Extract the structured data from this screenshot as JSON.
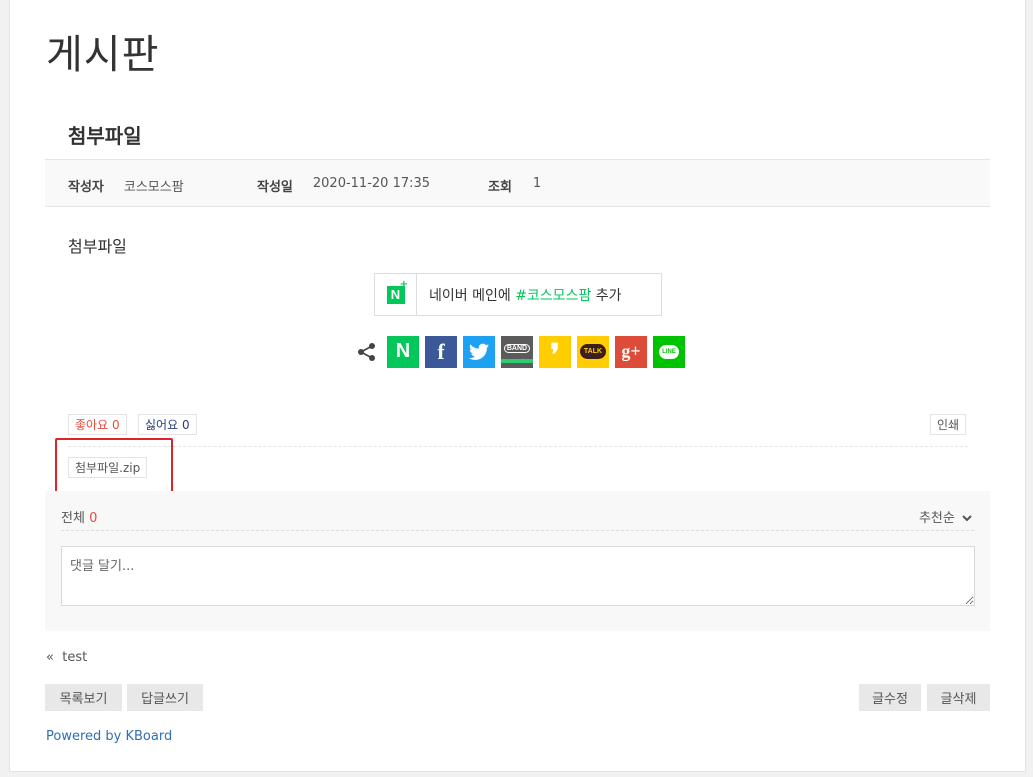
{
  "board": {
    "title": "게시판"
  },
  "post": {
    "title": "첨부파일",
    "author_label": "작성자",
    "author": "코스모스팜",
    "date_label": "작성일",
    "date": "2020-11-20 17:35",
    "views_label": "조회",
    "views": "1",
    "content": "첨부파일"
  },
  "naver": {
    "logo_letter": "N",
    "text_before": "네이버 메인에 ",
    "tag": "#코스모스팜",
    "text_after": " 추가",
    "color": "#03c75a"
  },
  "share": {
    "icon": "share-icon",
    "services": [
      {
        "id": "naver",
        "label": "N",
        "color": "#03c75a"
      },
      {
        "id": "facebook",
        "label": "f",
        "color": "#3b5998"
      },
      {
        "id": "twitter",
        "label": "twitter",
        "color": "#1da1f2"
      },
      {
        "id": "band",
        "label": "BAND",
        "color": "#5b5b5b"
      },
      {
        "id": "kakaostory",
        "label": "❜",
        "color": "#ffcd00"
      },
      {
        "id": "kakaotalk",
        "label": "TALK",
        "color": "#ffcd00"
      },
      {
        "id": "googleplus",
        "label": "g+",
        "color": "#dd4b39"
      },
      {
        "id": "line",
        "label": "LINE",
        "color": "#00c300"
      }
    ]
  },
  "actions": {
    "like_label": "좋아요",
    "like_count": "0",
    "dislike_label": "싫어요",
    "dislike_count": "0",
    "print_label": "인쇄"
  },
  "attachment": {
    "filename": "첨부파일.zip"
  },
  "comments": {
    "total_label": "전체",
    "total_count": "0",
    "sort_label": "추천순",
    "placeholder": "댓글 달기..."
  },
  "nav": {
    "prev_marker": "«",
    "prev_title": "test"
  },
  "buttons": {
    "list": "목록보기",
    "reply": "답글쓰기",
    "edit": "글수정",
    "delete": "글삭제"
  },
  "footer": {
    "powered": "Powered by KBoard"
  },
  "colors": {
    "accent_red": "#e74c3c",
    "link_blue": "#2f6fb3",
    "highlight": "#e0232b"
  }
}
